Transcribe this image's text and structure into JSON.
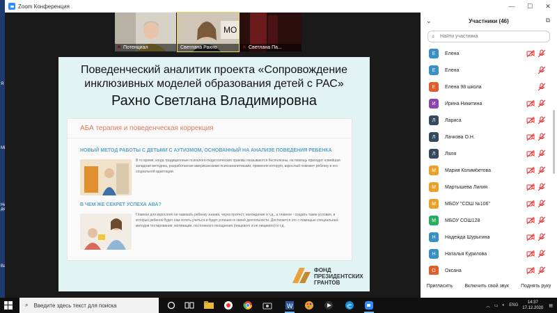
{
  "window": {
    "title": "Zoom Конференция",
    "buttons": [
      "—",
      "☐",
      "✕"
    ]
  },
  "desktop": {
    "icons": [
      "Я",
      "Mi",
      "Не де",
      "Ва"
    ]
  },
  "video": [
    {
      "name": "Потенциал",
      "muted": true
    },
    {
      "name": "Светлана Рахно",
      "muted": false,
      "sign": "МО"
    },
    {
      "name": "Светлана Па...",
      "muted": true
    }
  ],
  "slide": {
    "title_line1": "Поведенческий аналитик проекта «Сопровождение",
    "title_line2": "инклюзивных моделей образования детей с РАС»",
    "name": "Рахно Светлана Владимировна",
    "card_heading": "АБА терапия и поведенческая коррекция",
    "section1_title": "НОВЫЙ МЕТОД РАБОТЫ С ДЕТЬМИ С АУТИЗМОМ, ОСНОВАННЫЙ НА АНАЛИЗЕ ПОВЕДЕНИЯ РЕБЕНКА",
    "section1_text": "В то время, когда традиционные психолого-педагогические приемы оказываются бесполезны, на помощь приходит новейшая западная методика, разработанная американскими психоаналитиками, применяя которую, взрослый поможет ребенку в его социальной адаптации.",
    "section2_title": "В ЧЕМ ЖЕ СЕКРЕТ УСПЕХА АВА?",
    "section2_text": "Главное для взрослого не навязать ребенку знания, через протест, нахождение и т.д., а главное - создать такие условия, в которых ребенок будет сам хотеть учиться и будет успешен в своей деятельности. Достигается это с помощью специальных методов тестирования, мотивации, постоянного поощрения (пищевого и не пищевого) и т.д.",
    "fund_line1": "ФОНД",
    "fund_line2": "ПРЕЗИДЕНТСКИХ",
    "fund_line3": "ГРАНТОВ"
  },
  "participants": {
    "header": "Участники (46)",
    "search_placeholder": "Найти участника",
    "items": [
      {
        "initial": "Е",
        "name": "Елена",
        "color": "#3a8fc4",
        "video_off": true
      },
      {
        "initial": "Е",
        "name": "Елена",
        "color": "#3a8fc4",
        "video_off": false
      },
      {
        "initial": "Е",
        "name": "Елена 98 школа",
        "color": "#e35d2b",
        "video_off": false
      },
      {
        "initial": "И",
        "name": "Ирина Никитина",
        "color": "#8e44ad",
        "video_off": true
      },
      {
        "initial": "Л",
        "name": "Лариса",
        "color": "#34495e",
        "video_off": true
      },
      {
        "initial": "Л",
        "name": "Лачкова О.Н.",
        "color": "#34495e",
        "video_off": true
      },
      {
        "initial": "Л",
        "name": "Ляля",
        "color": "#34495e",
        "video_off": true
      },
      {
        "initial": "М",
        "name": "Мария Колимбетова",
        "color": "#e8a12a",
        "video_off": true
      },
      {
        "initial": "М",
        "name": "Мартышева Лилия",
        "color": "#e8a12a",
        "video_off": true
      },
      {
        "initial": "М",
        "name": "МБОУ \"СОШ №106\"",
        "color": "#e8a12a",
        "video_off": true
      },
      {
        "initial": "М",
        "name": "МБОУ СОШ128",
        "color": "#27ae60",
        "video_off": true
      },
      {
        "initial": "Н",
        "name": "Надежда Шурыгина",
        "color": "#3a8fc4",
        "video_off": true
      },
      {
        "initial": "Н",
        "name": "Наталья Курилова",
        "color": "#3a8fc4",
        "video_off": true
      },
      {
        "initial": "О",
        "name": "Оксана",
        "color": "#e35d2b",
        "video_off": true
      }
    ],
    "footer": {
      "invite": "Пригласить",
      "unmute": "Включить свой звук",
      "raise_hand": "Поднять руку"
    }
  },
  "taskbar": {
    "search_placeholder": "Введите здесь текст для поиска",
    "lang": "ENG",
    "time": "14:37",
    "date": "17.12.2020"
  }
}
